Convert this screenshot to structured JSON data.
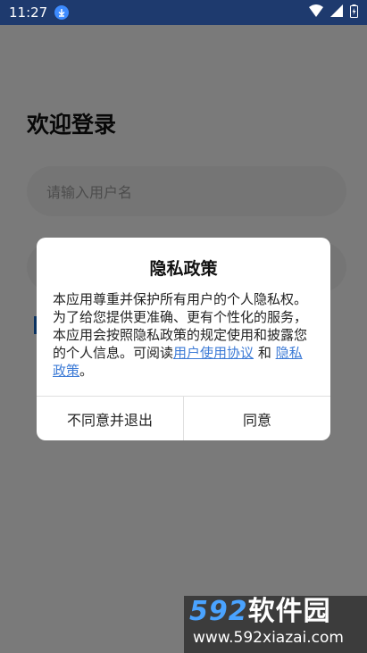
{
  "status_bar": {
    "time": "11:27",
    "icons": [
      "download-icon",
      "wifi-icon",
      "signal-icon",
      "battery-icon"
    ]
  },
  "login": {
    "title": "欢迎登录",
    "username_placeholder": "请输入用户名"
  },
  "dialog": {
    "title": "隐私政策",
    "body_text": "本应用尊重并保护所有用户的个人隐私权。为了给您提供更准确、更有个性化的服务，本应用会按照隐私政策的规定使用和披露您的个人信息。可阅读",
    "link_agreement": "用户使用协议",
    "and_text": "和",
    "link_policy": "隐私政策",
    "period": "。",
    "decline_button": "不同意并退出",
    "agree_button": "同意"
  },
  "watermark": {
    "brand_number": "592",
    "brand_text": "软件园",
    "url": "www.592xiazai.com"
  },
  "colors": {
    "status_bar": "#1e3a6e",
    "link": "#3d7bd6",
    "overlay": "rgba(0,0,0,0.5)",
    "checkbox": "#1565c0"
  }
}
